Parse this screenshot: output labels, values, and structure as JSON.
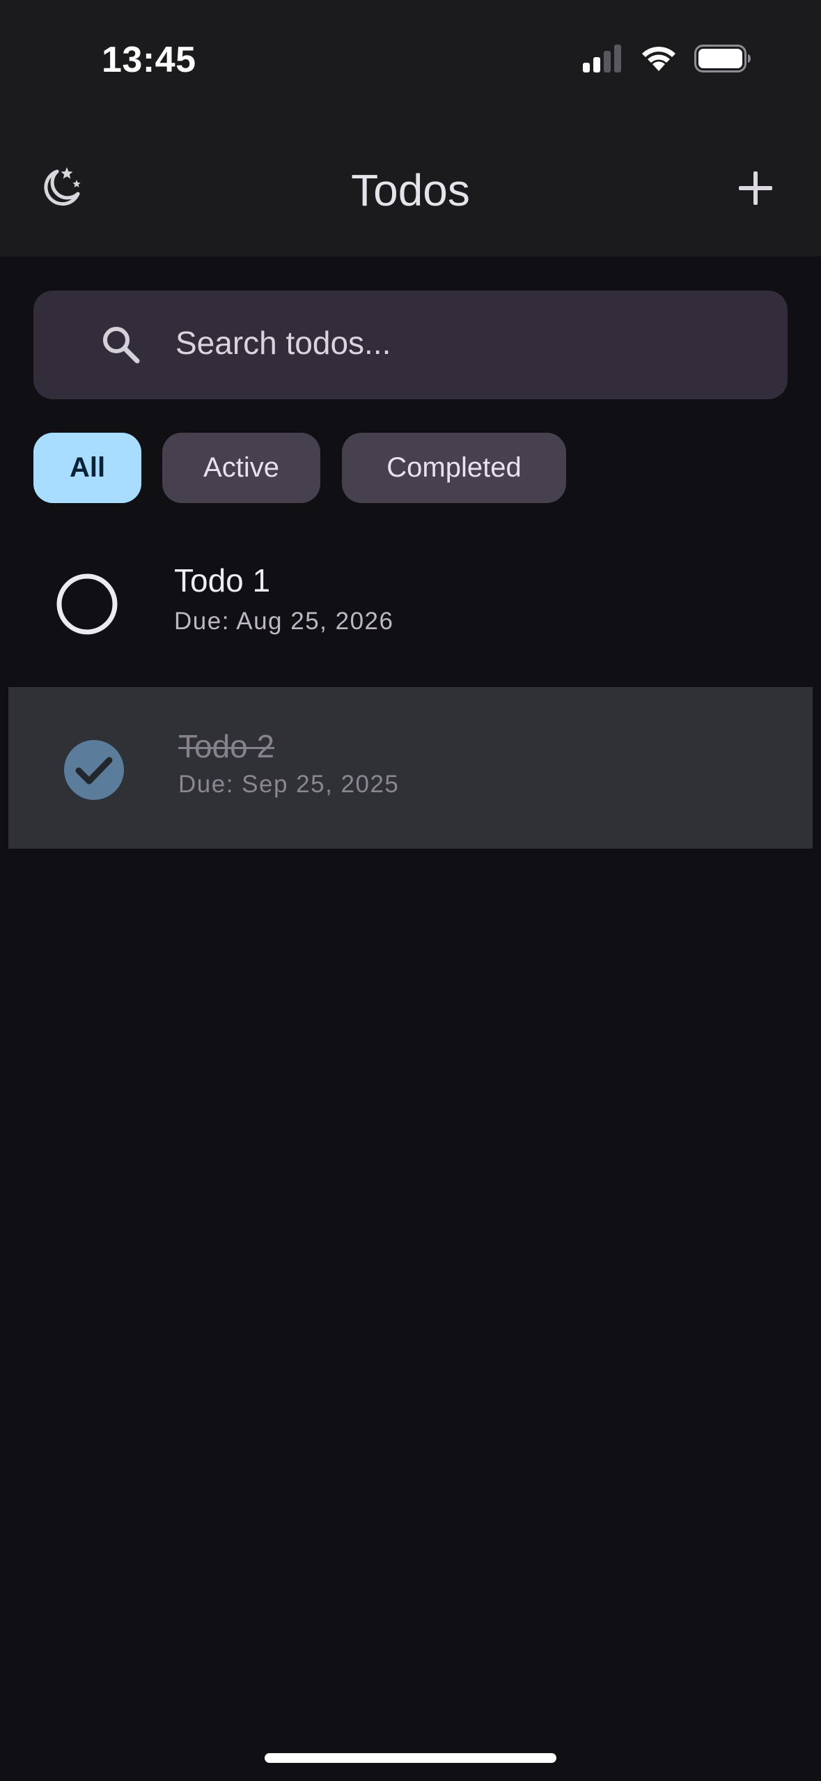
{
  "status_bar": {
    "time": "13:45"
  },
  "app_bar": {
    "title": "Todos",
    "leading_icon": "moon-stars-icon",
    "trailing_icon": "plus-icon"
  },
  "search": {
    "placeholder": "Search todos...",
    "icon": "search-icon"
  },
  "filters": [
    {
      "label": "All",
      "selected": true
    },
    {
      "label": "Active",
      "selected": false
    },
    {
      "label": "Completed",
      "selected": false
    }
  ],
  "todos": [
    {
      "title": "Todo 1",
      "due": "Due: Aug 25, 2026",
      "completed": false
    },
    {
      "title": "Todo 2",
      "due": "Due: Sep 25, 2025",
      "completed": true
    }
  ],
  "colors": {
    "background": "#101014",
    "app_bar": "#1b1b1e",
    "search_field": "#332d3b",
    "chip_selected": "#a8ddff",
    "chip_unselected": "#46404f",
    "completed_row": "#303037",
    "check_fill": "#5b7c9a"
  }
}
